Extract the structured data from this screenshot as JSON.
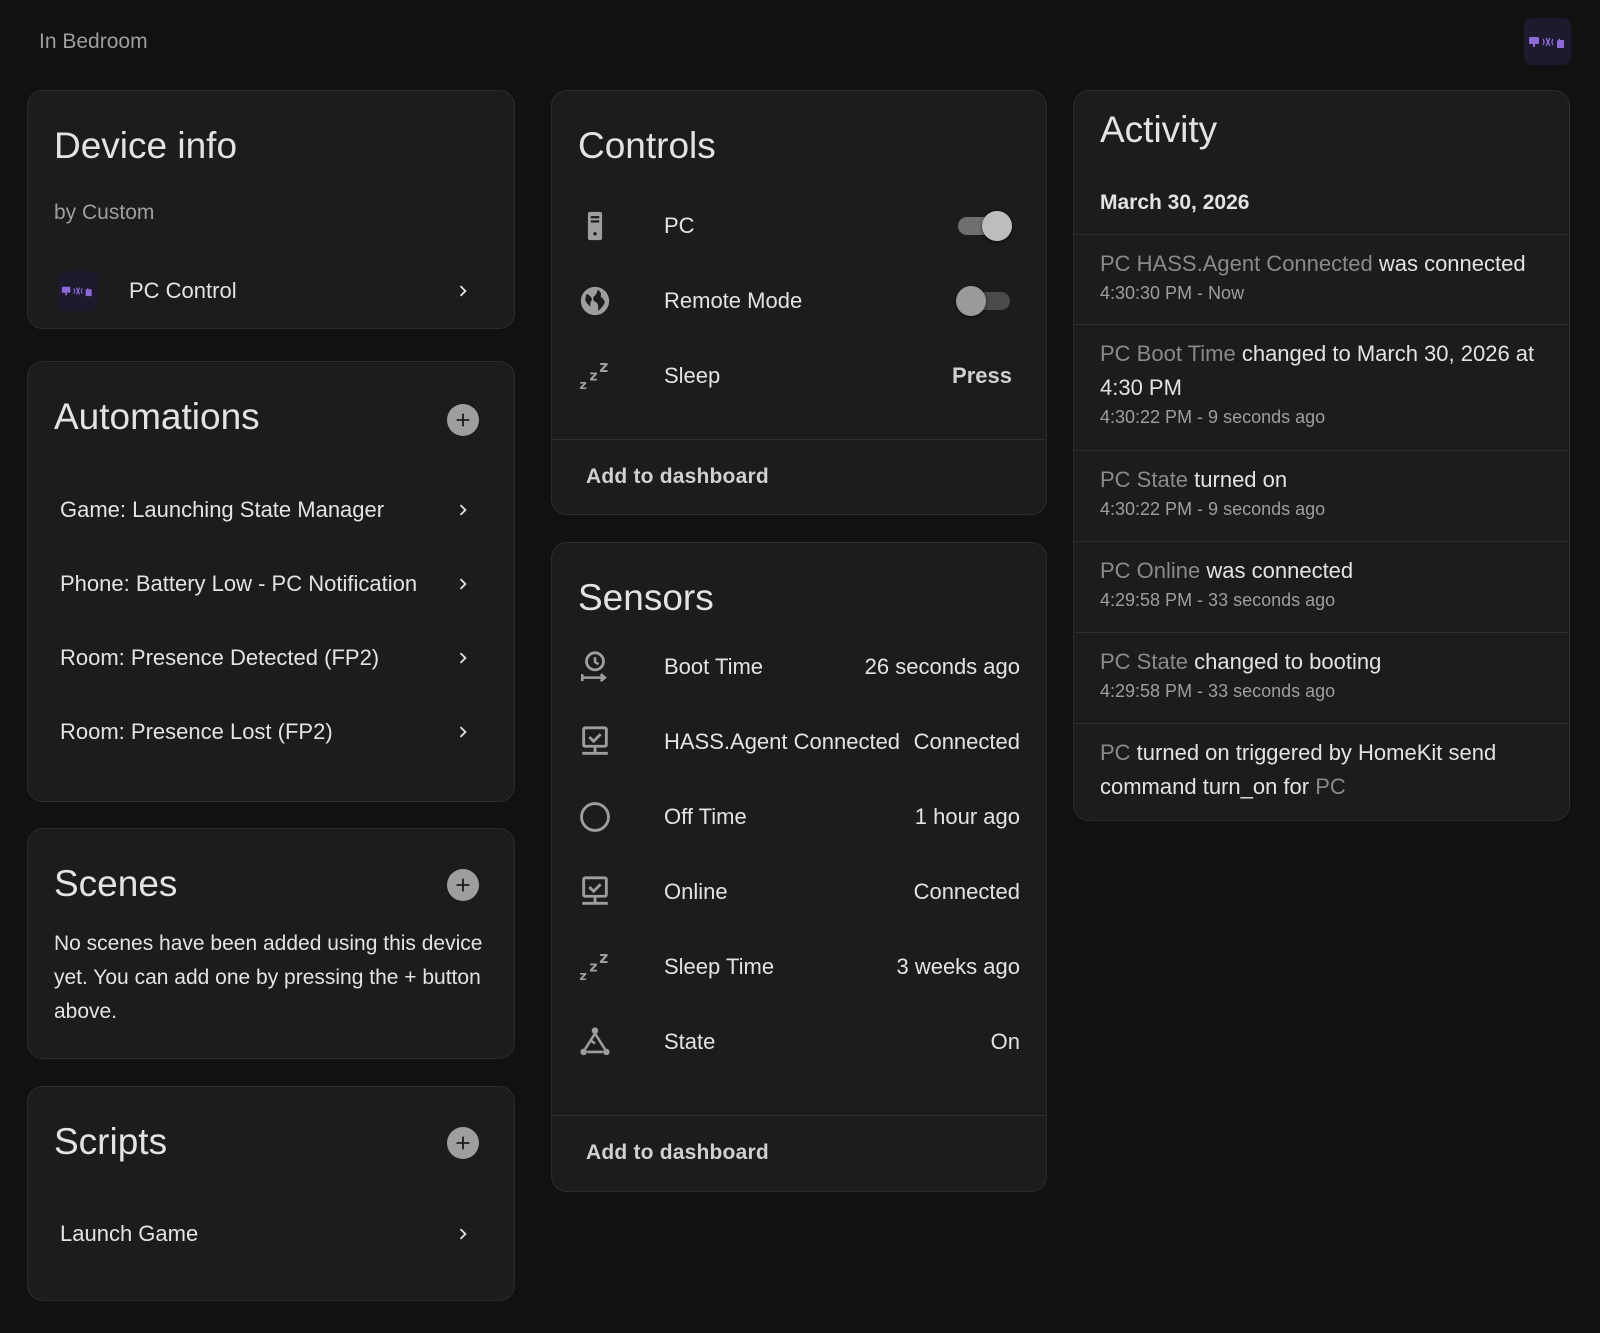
{
  "header": {
    "area": "In Bedroom"
  },
  "colors": {
    "accent": "#8d6ad8",
    "logo_bg": "#1d1a2d",
    "card_bg": "#1c1c1c",
    "page_bg": "#111111",
    "muted_entity": "#8a8a8a"
  },
  "device_info": {
    "title": "Device info",
    "manufacturer": "by Custom",
    "integration_label": "PC Control"
  },
  "automations": {
    "title": "Automations",
    "items": [
      {
        "label": "Game: Launching State Manager"
      },
      {
        "label": "Phone: Battery Low - PC Notification"
      },
      {
        "label": "Room: Presence Detected (FP2)"
      },
      {
        "label": "Room: Presence Lost (FP2)"
      }
    ]
  },
  "scenes": {
    "title": "Scenes",
    "empty_text": "No scenes have been added using this device yet. You can add one by pressing the + button above."
  },
  "scripts": {
    "title": "Scripts",
    "items": [
      {
        "label": "Launch Game"
      }
    ]
  },
  "controls": {
    "title": "Controls",
    "items": [
      {
        "name": "PC",
        "icon": "desktop-tower-icon",
        "type": "switch",
        "on": true
      },
      {
        "name": "Remote Mode",
        "icon": "web-globe-icon",
        "type": "switch",
        "on": false
      },
      {
        "name": "Sleep",
        "icon": "sleep-zzz-icon",
        "type": "button",
        "state": "Press"
      }
    ],
    "footer": "Add to dashboard"
  },
  "sensors": {
    "title": "Sensors",
    "items": [
      {
        "name": "Boot Time",
        "icon": "clock-start-icon",
        "state": "26 seconds ago"
      },
      {
        "name": "HASS.Agent Connected",
        "icon": "monitor-check-icon",
        "state": "Connected"
      },
      {
        "name": "Off Time",
        "icon": "circle-outline-icon",
        "state": "1 hour ago"
      },
      {
        "name": "Online",
        "icon": "monitor-check-icon",
        "state": "Connected"
      },
      {
        "name": "Sleep Time",
        "icon": "sleep-zzz-icon",
        "state": "3 weeks ago"
      },
      {
        "name": "State",
        "icon": "state-machine-icon",
        "state": "On"
      }
    ],
    "footer": "Add to dashboard"
  },
  "activity": {
    "title": "Activity",
    "date": "March 30, 2026",
    "entries": [
      {
        "parts": [
          {
            "t": "PC HASS.Agent Connected",
            "e": true
          },
          {
            "t": " was connected",
            "e": false
          }
        ],
        "time": "4:30:30 PM - Now"
      },
      {
        "parts": [
          {
            "t": "PC Boot Time",
            "e": true
          },
          {
            "t": " changed to March 30, 2026 at 4:30 PM",
            "e": false
          }
        ],
        "time": "4:30:22 PM - 9 seconds ago"
      },
      {
        "parts": [
          {
            "t": "PC State",
            "e": true
          },
          {
            "t": " turned on",
            "e": false
          }
        ],
        "time": "4:30:22 PM - 9 seconds ago"
      },
      {
        "parts": [
          {
            "t": "PC Online",
            "e": true
          },
          {
            "t": " was connected",
            "e": false
          }
        ],
        "time": "4:29:58 PM - 33 seconds ago"
      },
      {
        "parts": [
          {
            "t": "PC State",
            "e": true
          },
          {
            "t": " changed to booting",
            "e": false
          }
        ],
        "time": "4:29:58 PM - 33 seconds ago"
      },
      {
        "parts": [
          {
            "t": "PC",
            "e": true
          },
          {
            "t": " turned on triggered by HomeKit send command turn_on for ",
            "e": false
          },
          {
            "t": "PC",
            "e": true
          }
        ],
        "time": ""
      }
    ]
  }
}
